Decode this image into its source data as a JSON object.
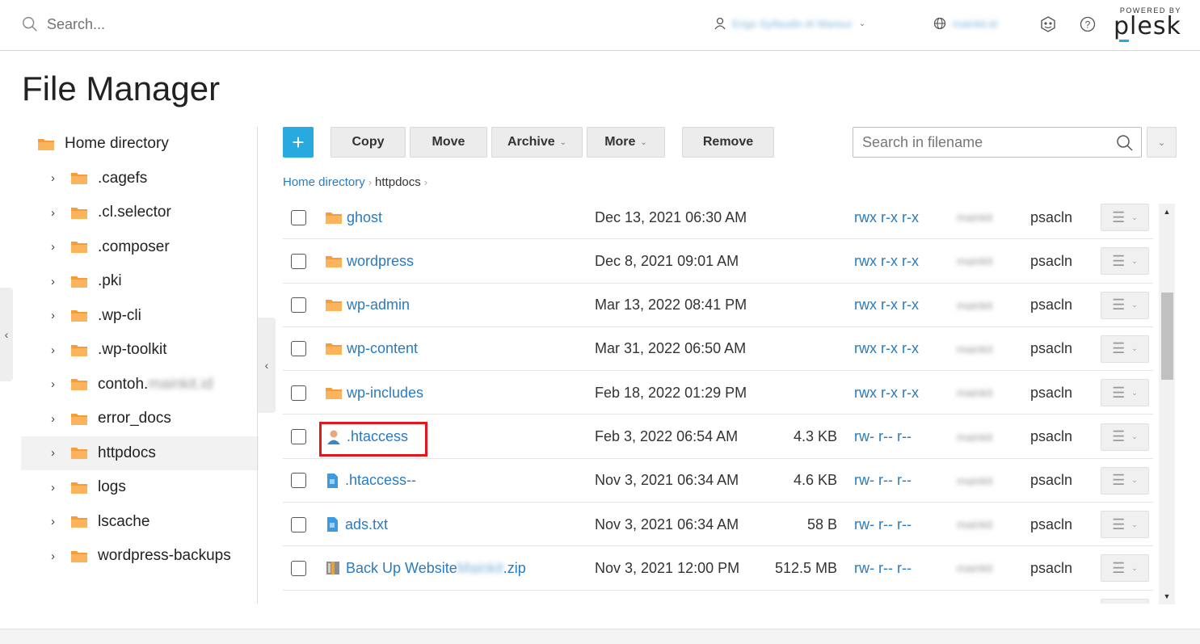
{
  "header": {
    "search_placeholder": "Search...",
    "user_name": "Erigo Syifaudin Al Mansur",
    "domain": "mainkit.id",
    "powered_by": "POWERED BY",
    "brand": "plesk"
  },
  "page": {
    "title": "File Manager"
  },
  "tree": {
    "root": {
      "label": "Home directory"
    },
    "items": [
      {
        "label": ".cagefs"
      },
      {
        "label": ".cl.selector"
      },
      {
        "label": ".composer"
      },
      {
        "label": ".pki"
      },
      {
        "label": ".wp-cli"
      },
      {
        "label": ".wp-toolkit"
      },
      {
        "label": "contoh.",
        "blurred": "mainkit.id"
      },
      {
        "label": "error_docs"
      },
      {
        "label": "httpdocs"
      },
      {
        "label": "logs"
      },
      {
        "label": "lscache"
      },
      {
        "label": "wordpress-backups"
      }
    ]
  },
  "toolbar": {
    "add_label": "+",
    "copy_label": "Copy",
    "move_label": "Move",
    "archive_label": "Archive",
    "more_label": "More",
    "remove_label": "Remove",
    "search_placeholder": "Search in filename"
  },
  "breadcrumb": {
    "home": "Home directory",
    "current": "httpdocs"
  },
  "files": [
    {
      "name": "ghost",
      "type": "folder",
      "date": "Dec 13, 2021 06:30 AM",
      "size": "",
      "perm": "rwx r-x r-x",
      "owner": "mainkit",
      "group": "psacln"
    },
    {
      "name": "wordpress",
      "type": "folder",
      "date": "Dec 8, 2021 09:01 AM",
      "size": "",
      "perm": "rwx r-x r-x",
      "owner": "mainkit",
      "group": "psacln"
    },
    {
      "name": "wp-admin",
      "type": "folder",
      "date": "Mar 13, 2022 08:41 PM",
      "size": "",
      "perm": "rwx r-x r-x",
      "owner": "mainkit",
      "group": "psacln"
    },
    {
      "name": "wp-content",
      "type": "folder",
      "date": "Mar 31, 2022 06:50 AM",
      "size": "",
      "perm": "rwx r-x r-x",
      "owner": "mainkit",
      "group": "psacln"
    },
    {
      "name": "wp-includes",
      "type": "folder",
      "date": "Feb 18, 2022 01:29 PM",
      "size": "",
      "perm": "rwx r-x r-x",
      "owner": "mainkit",
      "group": "psacln"
    },
    {
      "name": ".htaccess",
      "type": "user-file",
      "date": "Feb 3, 2022 06:54 AM",
      "size": "4.3 KB",
      "perm": "rw- r-- r--",
      "owner": "mainkit",
      "group": "psacln"
    },
    {
      "name": ".htaccess--",
      "type": "file",
      "date": "Nov 3, 2021 06:34 AM",
      "size": "4.6 KB",
      "perm": "rw- r-- r--",
      "owner": "mainkit",
      "group": "psacln"
    },
    {
      "name": "ads.txt",
      "type": "file",
      "date": "Nov 3, 2021 06:34 AM",
      "size": "58 B",
      "perm": "rw- r-- r--",
      "owner": "mainkit",
      "group": "psacln"
    },
    {
      "name": "Back Up Website ",
      "name_blurred": "Mainkit",
      "name_suffix": ".zip",
      "type": "archive",
      "date": "Nov 3, 2021 12:00 PM",
      "size": "512.5 MB",
      "perm": "rw- r-- r--",
      "owner": "mainkit",
      "group": "psacln"
    },
    {
      "name": "",
      "type": "file",
      "date": "",
      "size": "",
      "perm": "",
      "owner": "",
      "group": ""
    }
  ],
  "colors": {
    "accent": "#28aade",
    "link": "#2a7bbf",
    "folder": "#f59d3d",
    "highlight": "#e3161b"
  }
}
